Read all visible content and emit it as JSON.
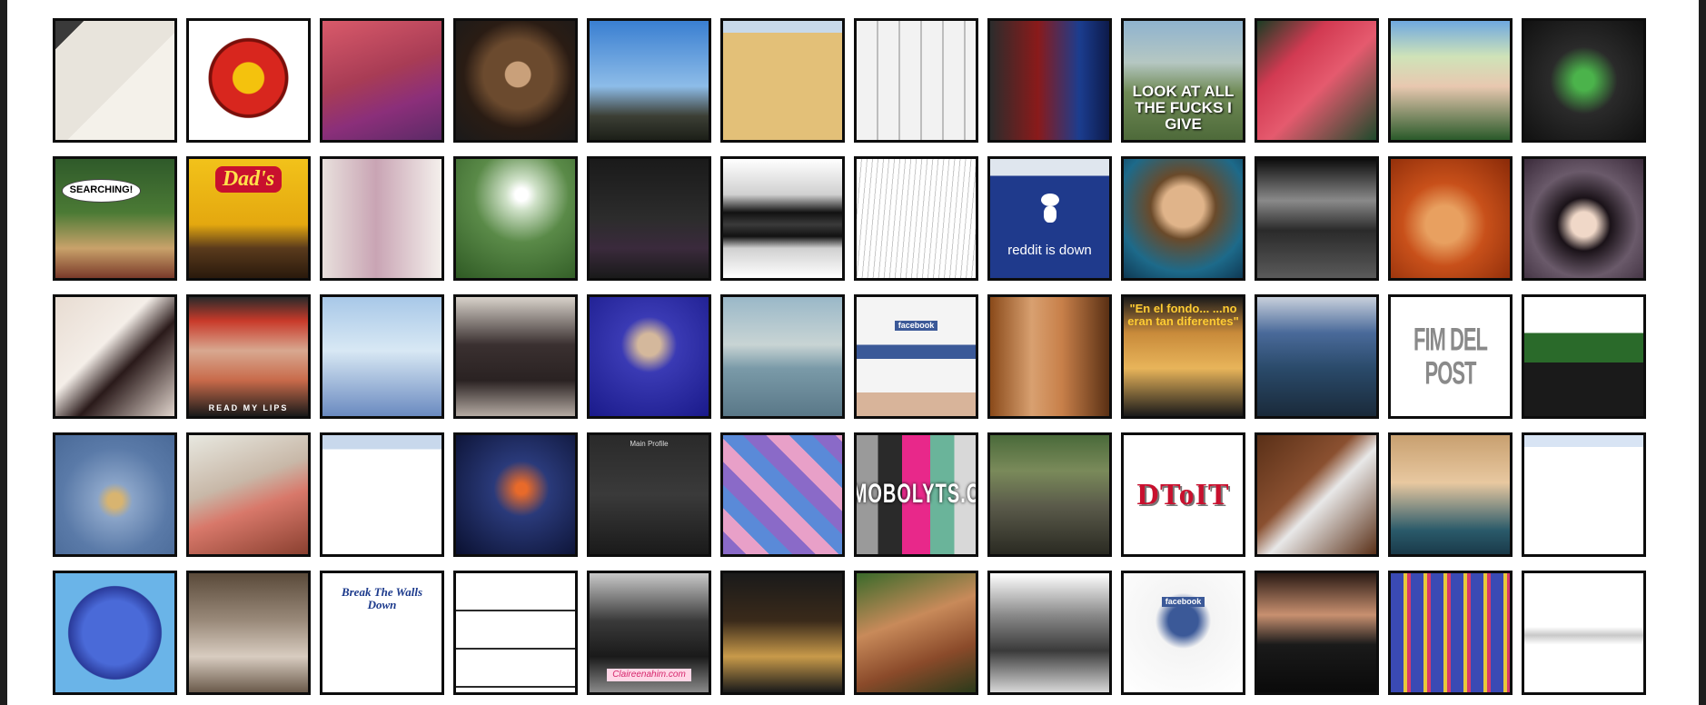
{
  "tiles": [
    {
      "bg": "linear-gradient(135deg,#3a3a3a 0 12%,#e8e4dc 12% 55%,#f4f1ea 55% 100%)",
      "caption": "",
      "variant": "v-none"
    },
    {
      "bg": "radial-gradient(circle at 50% 48%,#f4c20d 0 18%,#d8261e 19% 42%,#7a0f0a 43% 46%,#ffffff 47% 100%)",
      "caption": "",
      "variant": "v-none"
    },
    {
      "bg": "linear-gradient(160deg,#d95a6a 0%,#a83c55 45%,#8b2f7a 70%,#5b2a66 100%)",
      "caption": "",
      "variant": "v-none"
    },
    {
      "bg": "radial-gradient(circle at 52% 45%,#c9a07a 0 14%,#6b4a2e 15% 38%,#2a1c14 60%,#1a1a1a 100%)",
      "caption": "",
      "variant": "v-none"
    },
    {
      "bg": "linear-gradient(180deg,#3a7fd1 0%,#8dbce8 55%,#3c3f35 80%,#1c1f18 100%)",
      "caption": "",
      "variant": "v-none"
    },
    {
      "bg": "linear-gradient(180deg,#c8d9ea 0 10%,#e3c078 10% 100%)",
      "caption": "",
      "variant": "v-none"
    },
    {
      "bg": "repeating-linear-gradient(90deg,#f2f2f2 0 22px,#bdbdbd 22px 24px),#ddd",
      "caption": "",
      "variant": "v-none"
    },
    {
      "bg": "linear-gradient(90deg,#2c2c2c 0%,#8a1a1a 40%,#1b3d8f 75%,#0d1a4a 100%)",
      "caption": "",
      "variant": "v-none"
    },
    {
      "bg": "linear-gradient(180deg,#8fb3cf 0%,#b5c7c2 35%,#6f8a55 60%,#4e6a3a 100%)",
      "caption": "LOOK AT ALL THE FUCKS I GIVE",
      "variant": "v-look"
    },
    {
      "bg": "linear-gradient(135deg,#1b3d24 0%,#d23a52 30%,#e55a6e 55%,#1f4a2c 100%)",
      "caption": "",
      "variant": "v-none"
    },
    {
      "bg": "linear-gradient(180deg,#6fa8e0 0%,#cfe3b8 30%,#e8c8b0 55%,#2a5a2a 100%)",
      "caption": "",
      "variant": "v-none"
    },
    {
      "bg": "radial-gradient(circle at 50% 50%,#4bb34b 0 12%,#2a2a2a 40%,#111 100%)",
      "caption": "",
      "variant": "v-none"
    },
    {
      "bg": "linear-gradient(180deg,#2f5a2a 0%,#4b7a35 45%,#c9a26a 75%,#7a3a2a 100%)",
      "caption": "SEARCHING!",
      "variant": "v-speech"
    },
    {
      "bg": "linear-gradient(180deg,#f2c21a 0%,#e4a80f 55%,#5a3a1c 75%,#2a1a0c 100%)",
      "caption": "Dad's",
      "variant": "v-dads"
    },
    {
      "bg": "linear-gradient(90deg,#e8e0dc 0%,#c9a4b4 45%,#f4f0ec 100%)",
      "caption": "",
      "variant": "v-none"
    },
    {
      "bg": "radial-gradient(circle at 55% 30%,#ffffff 0 6%,#cfe1c8 15%,#5a8a48 45%,#2f5a24 100%)",
      "caption": "",
      "variant": "v-none"
    },
    {
      "bg": "linear-gradient(180deg,#1a1a1a 0%,#2c2c2c 50%,#3a2a3c 75%,#1a1a1a 100%)",
      "caption": "",
      "variant": "v-none"
    },
    {
      "bg": "linear-gradient(180deg,#ffffff 0%,#d0d0d0 30%,#111111 45%,#3a3a3a 55%,#111111 65%,#d0d0d0 75%,#ffffff 100%)",
      "caption": "",
      "variant": "v-none"
    },
    {
      "bg": "repeating-linear-gradient(95deg,#ffffff 0 5px,#c8c8c8 5px 6px)",
      "caption": "",
      "variant": "v-none"
    },
    {
      "bg": "linear-gradient(180deg,#dfe6ee 0 14%,#1f3a8c 14% 100%)",
      "caption": "reddit is down",
      "variant": "v-reddit"
    },
    {
      "bg": "radial-gradient(circle at 50% 40%,#e0b48a 0 22%,#6a4a2a 35%,#1d6a8a 70%,#0f3a55 100%)",
      "caption": "",
      "variant": "v-none"
    },
    {
      "bg": "linear-gradient(180deg,#0c0c0c 0%,#8a8a8a 35%,#2a2a2a 60%,#5a5a5a 100%)",
      "caption": "",
      "variant": "v-none"
    },
    {
      "bg": "radial-gradient(circle at 45% 55%,#e8a060 0 20%,#c8501a 45%,#8a2a08 100%)",
      "caption": "",
      "variant": "v-none"
    },
    {
      "bg": "radial-gradient(circle at 50% 55%,#f0d8c8 0 14%,#1a1218 30%,#6a5a6a 60%,#3a2a3a 100%)",
      "caption": "",
      "variant": "v-none"
    },
    {
      "bg": "linear-gradient(135deg,#e8dcd2 0%,#f4eee8 40%,#2a1a1a 60%,#e0d4cc 100%)",
      "caption": "",
      "variant": "v-none"
    },
    {
      "bg": "linear-gradient(180deg,#2a2a2a 0%,#c83a2a 20%,#d8a890 45%,#c86a4a 70%,#1a1a1a 100%)",
      "caption": "READ MY LIPS",
      "variant": "v-read"
    },
    {
      "bg": "linear-gradient(180deg,#a8c8e8 0%,#d8e8f4 45%,#6a8ac0 100%)",
      "caption": "",
      "variant": "v-none"
    },
    {
      "bg": "linear-gradient(180deg,#d8d2ca 0%,#3a3030 40%,#2a2222 70%,#b4aaa2 100%)",
      "caption": "",
      "variant": "v-none"
    },
    {
      "bg": "radial-gradient(circle at 50% 40%,#d4b89c 0 12%,#3a3ab4 30%,#1a1a8a 100%)",
      "caption": "",
      "variant": "v-none"
    },
    {
      "bg": "linear-gradient(180deg,#9ab8c8 0%,#c8d4d4 40%,#7a9aa8 60%,#5a7888 100%)",
      "caption": "",
      "variant": "v-none"
    },
    {
      "bg": "linear-gradient(180deg,#f4f4f4 0 40%,#3b5998 40% 52%,#f4f4f4 52% 80%,#d8b49a 80% 100%)",
      "caption": "facebook",
      "variant": "v-fb"
    },
    {
      "bg": "linear-gradient(90deg,#8a4a1a 0%,#d8a070 35%,#c8804a 60%,#5a3014 100%)",
      "caption": "",
      "variant": "v-none"
    },
    {
      "bg": "linear-gradient(180deg,#1a1a1a 0%,#c88a3a 30%,#e8b45a 60%,#1a1a1a 100%)",
      "caption": "\"En el fondo... ...no eran tan diferentes\"",
      "variant": "v-fondo"
    },
    {
      "bg": "linear-gradient(180deg,#c8d0dc 0%,#4a6a9a 30%,#2a4a6a 60%,#1a2a3a 100%)",
      "caption": "",
      "variant": "v-none"
    },
    {
      "bg": "#ffffff",
      "caption": "FIM DEL POST",
      "variant": "v-fim"
    },
    {
      "bg": "linear-gradient(180deg,#ffffff 0 30%,#2a6a2a 30% 55%,#1a1a1a 55% 100%)",
      "caption": "",
      "variant": "v-none"
    },
    {
      "bg": "radial-gradient(circle at 50% 55%,#d8b470 0 8%,#8aa4c8 20%,#5a7aa8 60%,#4a6a98 100%)",
      "caption": "",
      "variant": "v-none"
    },
    {
      "bg": "linear-gradient(160deg,#e8e8e0 0%,#c8b8a8 40%,#d8786a 60%,#8a4030 100%)",
      "caption": "",
      "variant": "v-none"
    },
    {
      "bg": "linear-gradient(180deg,#c8d8ec 0 12%,#ffffff 12% 100%)",
      "caption": "",
      "variant": "v-none"
    },
    {
      "bg": "radial-gradient(circle at 55% 45%,#e86a2a 0 6%,#2a3a7a 30%,#0a1030 100%)",
      "caption": "",
      "variant": "v-none"
    },
    {
      "bg": "linear-gradient(180deg,#2a2a2a 0%,#3a3a3a 50%,#1a1a1a 100%)",
      "caption": "Main Profile",
      "variant": "v-mono"
    },
    {
      "bg": "repeating-linear-gradient(45deg,#8a6ac8 0 18px,#e8a0c8 18px 36px,#5a8ad8 36px 54px)",
      "caption": "",
      "variant": "v-none"
    },
    {
      "bg": "linear-gradient(90deg,#9a9a9a 0 18%,#2a2a2a 18% 38%,#e8288a 38% 62%,#6ab49a 62% 82%,#d8d8d8 82% 100%)",
      "caption": "SLIMOBOLYTS.COM",
      "variant": "v-slim"
    },
    {
      "bg": "linear-gradient(180deg,#4a6a3a 0%,#7a8a5a 30%,#5a5a4a 60%,#2a2a22 100%)",
      "caption": "",
      "variant": "v-none"
    },
    {
      "bg": "#ffffff",
      "caption": "DToIT",
      "variant": "v-dtolt"
    },
    {
      "bg": "linear-gradient(135deg,#5a3018 0%,#8a5030 40%,#e8e8e8 55%,#5a3018 100%)",
      "caption": "",
      "variant": "v-none"
    },
    {
      "bg": "linear-gradient(180deg,#c8a070 0%,#e8c8a0 40%,#2a5a6a 80%,#1a3a4a 100%)",
      "caption": "",
      "variant": "v-none"
    },
    {
      "bg": "linear-gradient(180deg,#d8e4f4 0 10%,#ffffff 10% 100%)",
      "caption": "",
      "variant": "v-none"
    },
    {
      "bg": "radial-gradient(circle at 50% 50%,#4a6ad8 0 38%,#2a3a9a 55%,#6ab4e8 56% 100%)",
      "caption": "",
      "variant": "v-none"
    },
    {
      "bg": "linear-gradient(180deg,#5a4a3a 0%,#9a8a7a 40%,#d8ccc0 70%,#6a5a4a 100%)",
      "caption": "",
      "variant": "v-none"
    },
    {
      "bg": "#ffffff",
      "caption": "Break The Walls Down",
      "variant": "v-break"
    },
    {
      "bg": "repeating-linear-gradient(180deg,#ffffff 0 40px,#2a2a2a 40px 42px)",
      "caption": "",
      "variant": "v-none"
    },
    {
      "bg": "linear-gradient(180deg,#c8c8c8 0%,#3a3a3a 40%,#1a1a1a 70%,#8a8a8a 100%)",
      "caption": "Claireenahim.com",
      "variant": "v-pink"
    },
    {
      "bg": "linear-gradient(180deg,#1a1a1a 0%,#3a2a1a 40%,#c89a4a 70%,#1a1a1a 100%)",
      "caption": "",
      "variant": "v-none"
    },
    {
      "bg": "linear-gradient(160deg,#3a6a2a 0%,#c88a5a 40%,#8a4a2a 70%,#2a3a1a 100%)",
      "caption": "",
      "variant": "v-none"
    },
    {
      "bg": "linear-gradient(180deg,#ffffff 0%,#8a8a8a 35%,#3a3a3a 65%,#d8d8d8 100%)",
      "caption": "",
      "variant": "v-none"
    },
    {
      "bg": "radial-gradient(circle at 50% 40%,#3b5998 0 16%,#f4f4f4 30%,#ffffff 100%)",
      "caption": "facebook",
      "variant": "v-fb"
    },
    {
      "bg": "linear-gradient(180deg,#2a1a14 0%,#c89070 35%,#1a1a1a 60%,#0a0a0a 100%)",
      "caption": "",
      "variant": "v-none"
    },
    {
      "bg": "repeating-linear-gradient(90deg,#3a4ab4 0 14px,#e8c83a 14px 18px,#d83a6a 18px 22px)",
      "caption": "",
      "variant": "v-none"
    },
    {
      "bg": "linear-gradient(180deg,#ffffff 0 45%,#c8c8c8 52%,#ffffff 60% 100%)",
      "caption": "",
      "variant": "v-none"
    }
  ]
}
